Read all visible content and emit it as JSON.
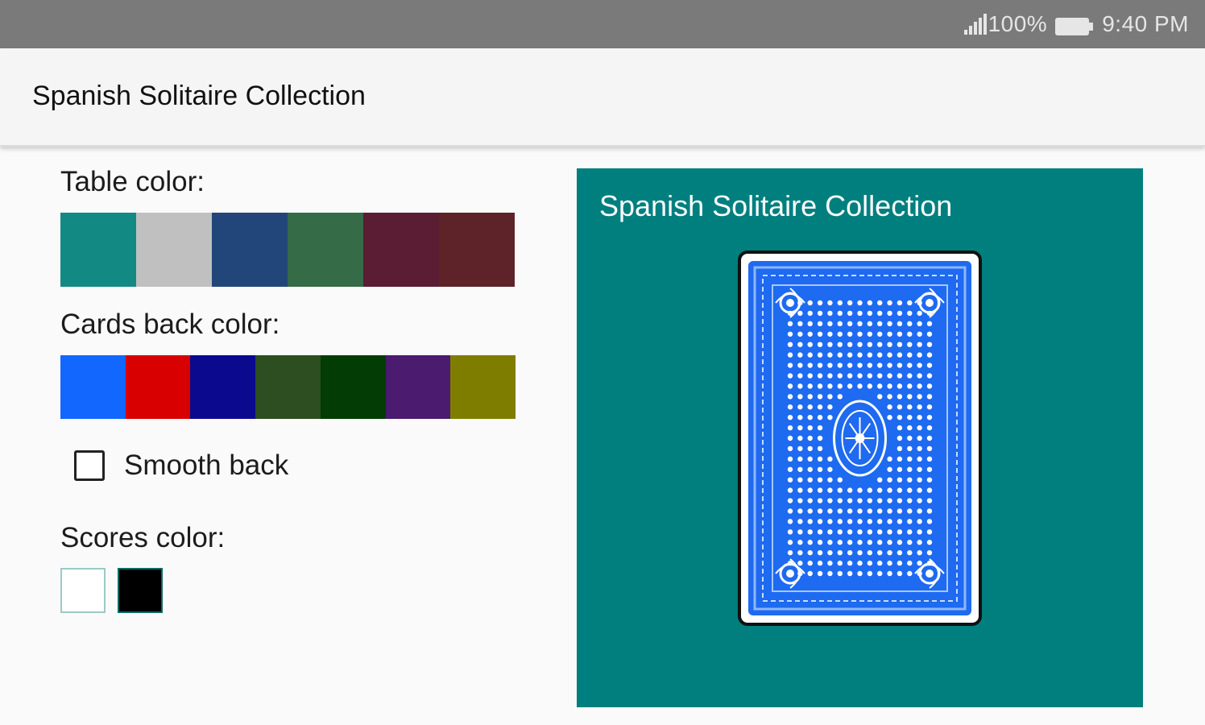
{
  "status_bar": {
    "battery_percent": "100%",
    "time": "9:40 PM"
  },
  "app_bar": {
    "title": "Spanish Solitaire Collection"
  },
  "table_color": {
    "label": "Table color:",
    "colors": [
      "#128a83",
      "#c0c0c0",
      "#22467a",
      "#356b47",
      "#5a1d33",
      "#5e2329"
    ]
  },
  "card_back_color": {
    "label": "Cards back color:",
    "colors": [
      "#1267ff",
      "#d80000",
      "#0b0a8e",
      "#2c4e20",
      "#033c05",
      "#4a1b6e",
      "#7f7d00"
    ]
  },
  "smooth_back": {
    "label": "Smooth back",
    "checked": false
  },
  "scores_color": {
    "label": "Scores color:",
    "colors": [
      "#ffffff",
      "#000000"
    ]
  },
  "preview": {
    "title": "Spanish Solitaire Collection",
    "table_color": "#007f7f",
    "card_back_color": "#1e6af0"
  },
  "icons": {
    "signal": "signal-icon",
    "battery": "battery-icon",
    "checkbox": "checkbox-icon"
  }
}
